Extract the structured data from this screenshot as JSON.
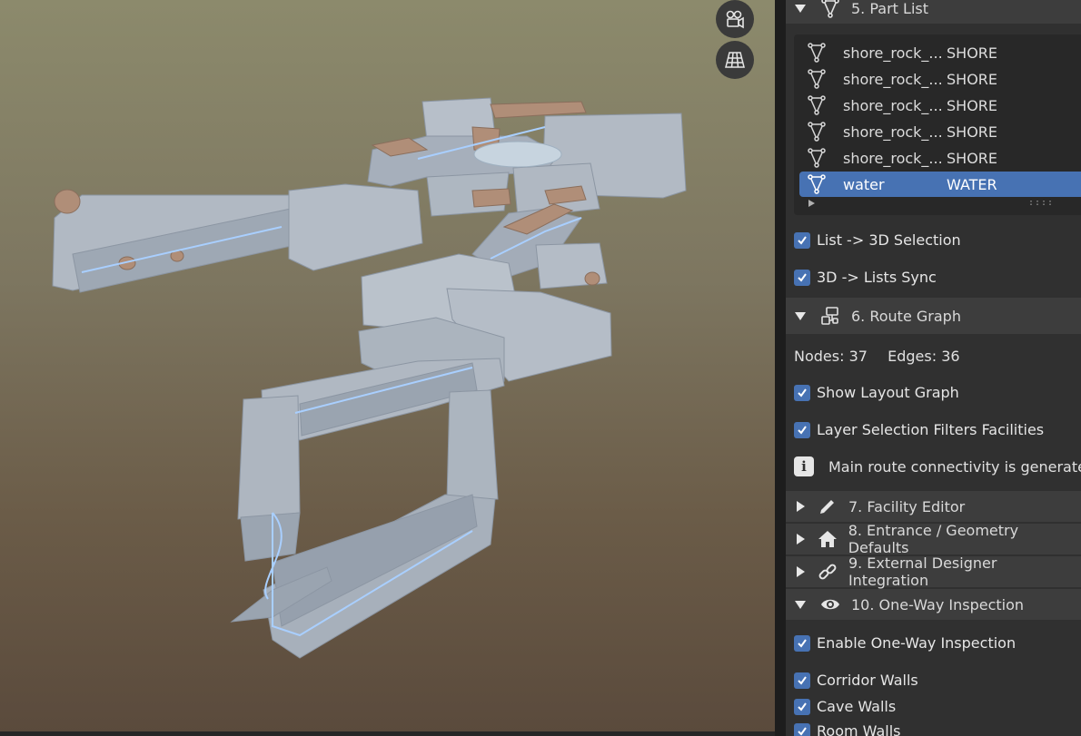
{
  "viewport": {
    "gizmos": {
      "camera": "camera-icon",
      "grid": "perspective-grid-icon"
    }
  },
  "part_list": {
    "title": "5. Part List",
    "icon": "mesh-icon",
    "items": [
      {
        "name": "shore_rock_...",
        "layer": "SHORE",
        "selected": false
      },
      {
        "name": "shore_rock_...",
        "layer": "SHORE",
        "selected": false
      },
      {
        "name": "shore_rock_...",
        "layer": "SHORE",
        "selected": false
      },
      {
        "name": "shore_rock_...",
        "layer": "SHORE",
        "selected": false
      },
      {
        "name": "shore_rock_...",
        "layer": "SHORE",
        "selected": false
      },
      {
        "name": "water",
        "layer": "WATER",
        "selected": true
      }
    ],
    "list_to_3d": "List -> 3D Selection",
    "sync_3d_lists": "3D -> Lists Sync"
  },
  "route_graph": {
    "title": "6. Route Graph",
    "nodes_text": "Nodes: 37",
    "edges_text": "Edges: 36",
    "show_layout_graph": "Show Layout Graph",
    "layer_filters": "Layer Selection Filters Facilities",
    "info": "Main route connectivity is generated"
  },
  "sections": [
    {
      "title": "7. Facility Editor",
      "icon": "pencil-icon"
    },
    {
      "title": "8. Entrance / Geometry Defaults",
      "icon": "home-icon"
    },
    {
      "title": "9. External Designer Integration",
      "icon": "link-icon"
    }
  ],
  "one_way": {
    "title": "10. One-Way Inspection",
    "icon": "eye-icon",
    "enable": "Enable One-Way Inspection",
    "corridor_walls": "Corridor Walls",
    "cave_walls": "Cave Walls",
    "room_walls": "Room Walls"
  },
  "colors": {
    "accent": "#4772b3",
    "panel_bg": "#303030",
    "header_bg": "#3d3d3d"
  }
}
